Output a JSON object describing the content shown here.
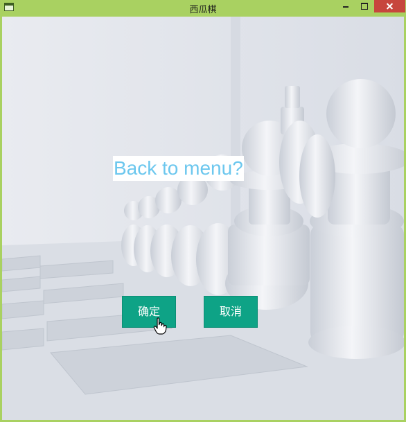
{
  "window": {
    "title": "西瓜棋"
  },
  "dialog": {
    "prompt": "Back to menu?",
    "confirm_label": "确定",
    "cancel_label": "取消"
  },
  "colors": {
    "title_bar": "#a9d161",
    "close_button": "#c7463d",
    "button": "#0ea386",
    "prompt_text": "#6cc7ee"
  },
  "icons": [
    "app-icon",
    "minimize-icon",
    "maximize-icon",
    "close-icon",
    "hand-cursor-icon"
  ]
}
